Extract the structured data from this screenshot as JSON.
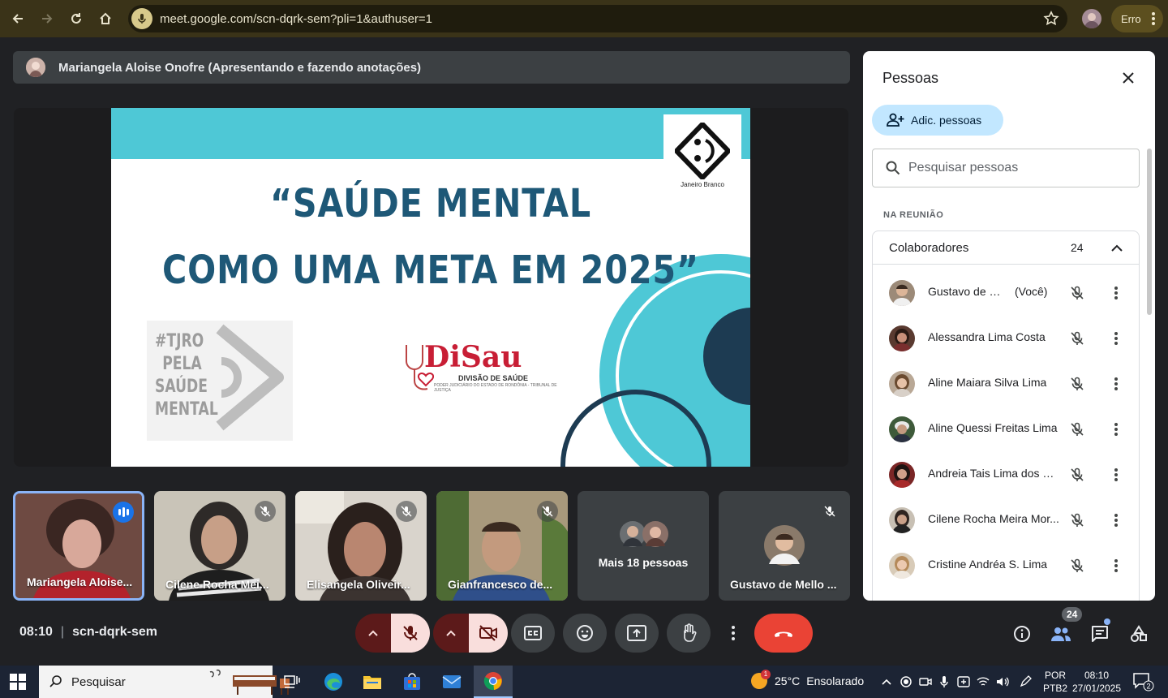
{
  "browser": {
    "url": "meet.google.com/scn-dqrk-sem?pli=1&authuser=1",
    "profile_label": "Erro"
  },
  "presenter_banner": "Mariangela Aloise Onofre (Apresentando e fazendo anotações)",
  "slide": {
    "logo_caption": "Janeiro Branco",
    "title_line1": "“SAÚDE MENTAL",
    "title_line2": "COMO UMA META EM 2025”",
    "tjro_text": "#TJRO PELA SAÚDE MENTAL",
    "disau_name": "DiSau",
    "disau_sub": "DIVISÃO DE SAÚDE",
    "disau_sub2": "PODER JUDICIÁRIO DO ESTADO DE RONDÔNIA - TRIBUNAL DE JUSTIÇA"
  },
  "tiles": [
    {
      "name": "Mariangela Aloise...",
      "speaking": true
    },
    {
      "name": "Cilene Rocha Mei...",
      "muted": true
    },
    {
      "name": "Elisangela Oliveir...",
      "muted": true
    },
    {
      "name": "Gianfrancesco de...",
      "muted": true
    },
    {
      "name": "Mais 18 pessoas"
    },
    {
      "name": "Gustavo de Mello ...",
      "muted": true
    }
  ],
  "meeting": {
    "time": "08:10",
    "code": "scn-dqrk-sem",
    "participant_count": "24"
  },
  "panel": {
    "title": "Pessoas",
    "add_label": "Adic. pessoas",
    "search_placeholder": "Pesquisar pessoas",
    "section_label": "NA REUNIÃO",
    "group_title": "Colaboradores",
    "group_count": "24",
    "people": [
      {
        "name": "Gustavo de Mell...",
        "you": "(Você)"
      },
      {
        "name": "Alessandra Lima Costa"
      },
      {
        "name": "Aline Maiara Silva Lima"
      },
      {
        "name": "Aline Quessi Freitas Lima"
      },
      {
        "name": "Andreia Tais Lima dos S..."
      },
      {
        "name": "Cilene Rocha Meira Mor..."
      },
      {
        "name": "Cristine Andréa S. Lima"
      }
    ]
  },
  "taskbar": {
    "search_label": "Pesquisar",
    "weather_badge": "1",
    "temperature": "25°C",
    "condition": "Ensolarado",
    "lang_line1": "POR",
    "lang_line2": "PTB2",
    "clock_time": "08:10",
    "clock_date": "27/01/2025",
    "notif_count": "2"
  },
  "colors": {
    "accent": "#8ab4f8",
    "hangup": "#ea4335",
    "slide_band": "#4ec8d6",
    "slide_title": "#1e5877",
    "disau_red": "#c81e35"
  }
}
